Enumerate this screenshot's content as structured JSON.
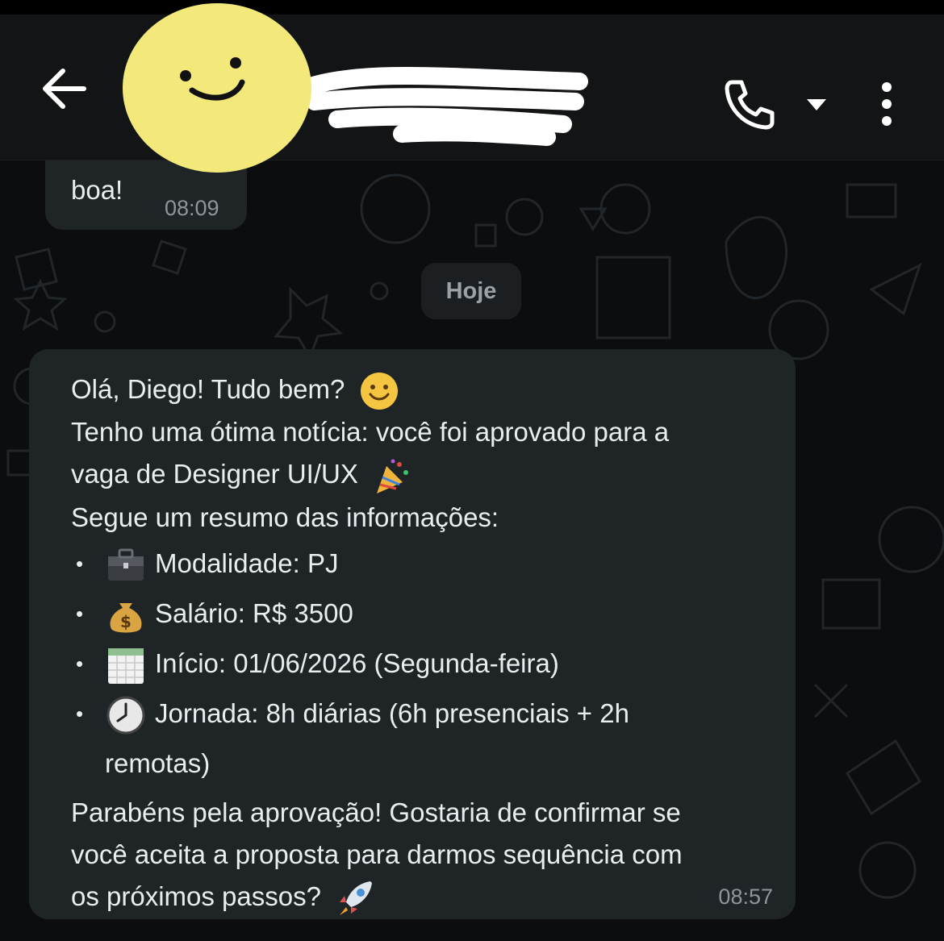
{
  "header": {
    "back_icon": "arrow-left-icon",
    "avatar_icon": "smiley-face-icon",
    "call_icon": "phone-icon",
    "dropdown_icon": "caret-down-icon",
    "menu_icon": "vertical-dots-icon"
  },
  "messages": {
    "previous": {
      "text": "boa!",
      "time": "08:09"
    },
    "date_separator": "Hoje",
    "main": {
      "greeting": "Olá, Diego! Tudo bem?",
      "line2": "Tenho uma ótima notícia: você foi aprovado para a",
      "line3": "vaga de Designer UI/UX",
      "line4": "Segue um resumo das informações:",
      "bullets": [
        {
          "text": "Modalidade: PJ",
          "icon": "briefcase-icon"
        },
        {
          "text": "Salário: R$ 3500",
          "icon": "money-bag-icon"
        },
        {
          "text": "Início: 01/06/2026 (Segunda-feira)",
          "icon": "calendar-icon"
        },
        {
          "text": "Jornada: 8h diárias (6h presenciais + 2h",
          "continuation": "remotas)",
          "icon": "clock-icon"
        }
      ],
      "closing1": "Parabéns pela aprovação! Gostaria de confirmar se",
      "closing2": "você aceita a proposta para darmos sequência com",
      "closing3": "os próximos passos?",
      "time": "08:57"
    }
  },
  "colors": {
    "background": "#0b0d0e",
    "header": "#121415",
    "bubble": "#1f2427",
    "text": "#e9edef",
    "timestamp": "#8e9699",
    "avatar": "#f2e97a"
  }
}
